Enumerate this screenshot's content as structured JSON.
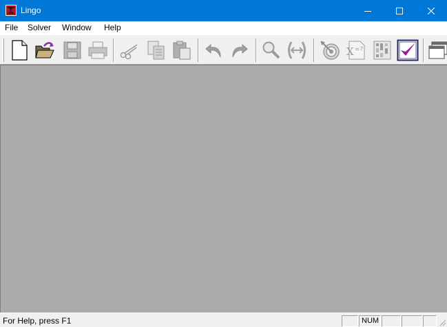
{
  "window": {
    "title": "Lingo",
    "titlebar_color": "#0078d7",
    "workspace_color": "#ababab"
  },
  "menu": {
    "items": [
      "File",
      "Solver",
      "Window",
      "Help"
    ]
  },
  "toolbar": {
    "buttons": [
      {
        "icon": "new-document-icon",
        "enabled": true
      },
      {
        "icon": "open-folder-icon",
        "enabled": true
      },
      {
        "icon": "save-disk-icon",
        "enabled": false
      },
      {
        "icon": "print-icon",
        "enabled": false
      },
      {
        "icon": "cut-scissors-icon",
        "enabled": false
      },
      {
        "icon": "copy-icon",
        "enabled": false
      },
      {
        "icon": "paste-icon",
        "enabled": false
      },
      {
        "icon": "undo-icon",
        "enabled": false
      },
      {
        "icon": "redo-icon",
        "enabled": false
      },
      {
        "icon": "find-magnifier-icon",
        "enabled": false
      },
      {
        "icon": "match-parenthesis-icon",
        "enabled": false
      },
      {
        "icon": "solve-target-icon",
        "enabled": false
      },
      {
        "icon": "formula-icon",
        "enabled": false
      },
      {
        "icon": "matrix-picture-icon",
        "enabled": false
      },
      {
        "icon": "options-checkmark-icon",
        "enabled": true
      },
      {
        "icon": "window-cascade-icon",
        "enabled": true
      }
    ]
  },
  "status": {
    "help_text": "For Help, press F1",
    "num_indicator": "NUM"
  }
}
